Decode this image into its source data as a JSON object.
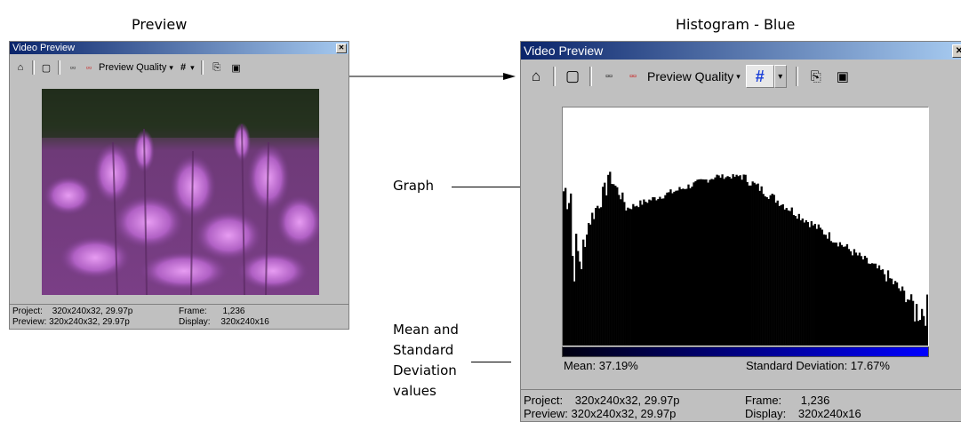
{
  "captions": {
    "left": "Preview",
    "right": "Histogram - Blue"
  },
  "callouts": {
    "graph": "Graph",
    "mean_sd": [
      "Mean and",
      "Standard",
      "Deviation",
      "values"
    ]
  },
  "window": {
    "title": "Video Preview",
    "close": "✕"
  },
  "toolbar": {
    "properties_icon": "⌂",
    "overlay_icon": "▢",
    "split_icon": "▫▫",
    "split_x_icon": "▫▫",
    "quality_label": "Preview Quality",
    "quality_arrow": "▾",
    "grid_icon": "#",
    "grid_arrow": "▾",
    "copy_icon": "⎘",
    "save_icon": "▣"
  },
  "status": {
    "project_label": "Project:",
    "project_value": "320x240x32, 29.97p",
    "preview_label": "Preview:",
    "preview_value": "320x240x32, 29.97p",
    "frame_label": "Frame:",
    "frame_value": "1,236",
    "display_label": "Display:",
    "display_value": "320x240x16"
  },
  "histogram": {
    "mean": "Mean: 37.19%",
    "std_dev": "Standard Deviation: 17.67%",
    "bar_color": "#000000",
    "gradient_end": "#0000ff"
  }
}
